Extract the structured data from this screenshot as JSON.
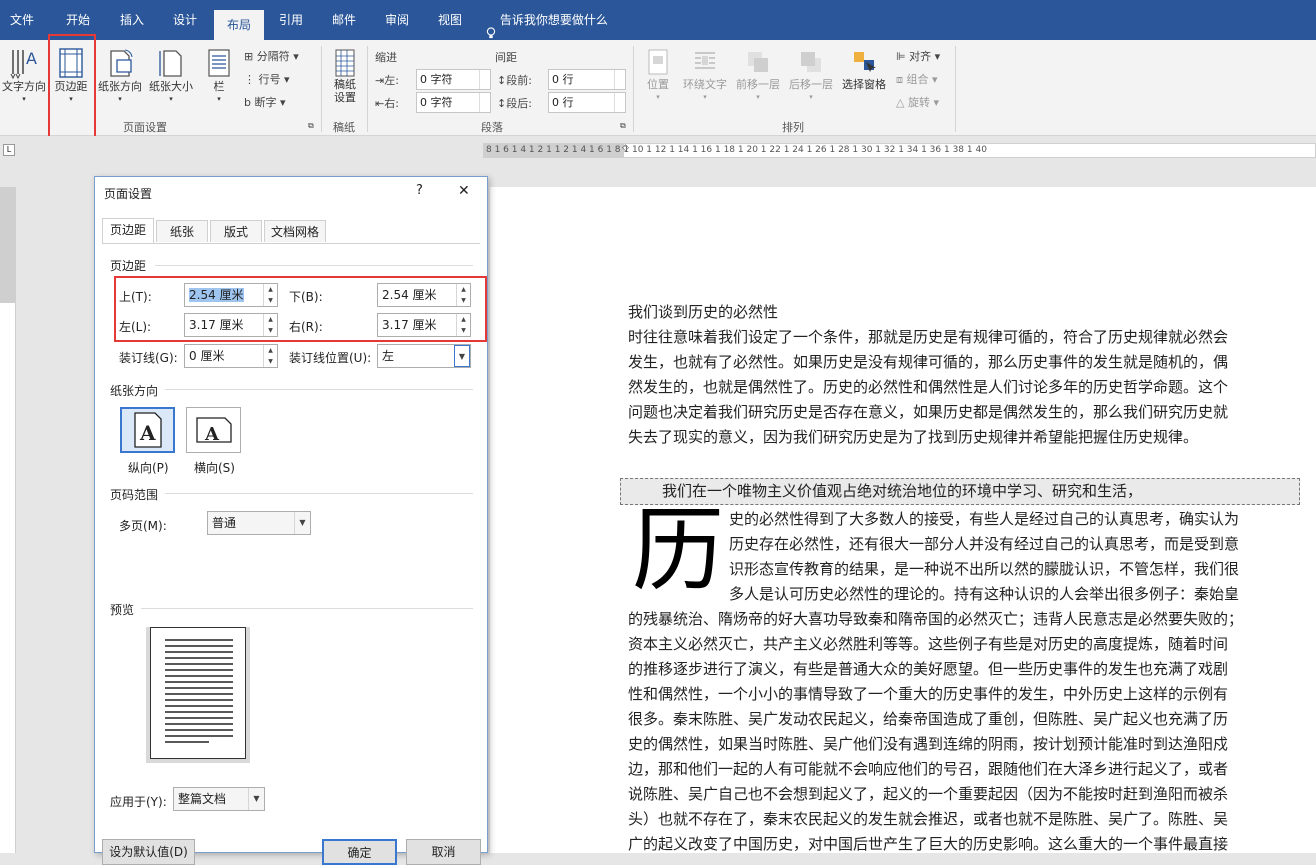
{
  "tabs": [
    {
      "label": "文件",
      "active": false
    },
    {
      "label": "开始",
      "active": false
    },
    {
      "label": "插入",
      "active": false
    },
    {
      "label": "设计",
      "active": false
    },
    {
      "label": "布局",
      "active": true
    },
    {
      "label": "引用",
      "active": false
    },
    {
      "label": "邮件",
      "active": false
    },
    {
      "label": "审阅",
      "active": false
    },
    {
      "label": "视图",
      "active": false
    }
  ],
  "tellme": "告诉我你想要做什么",
  "ribbon": {
    "page_setup": {
      "text_direction": "文字方向",
      "margins": "页边距",
      "orientation": "纸张方向",
      "size": "纸张大小",
      "columns": "栏",
      "breaks": "分隔符",
      "line_numbers": "行号",
      "hyphenation": "断字",
      "group_label": "页面设置"
    },
    "draft": {
      "label1": "稿纸",
      "label2": "设置",
      "group_label": "稿纸"
    },
    "paragraph": {
      "indent_label": "缩进",
      "spacing_label": "间距",
      "left_label": "左:",
      "left_value": "0 字符",
      "right_label": "右:",
      "right_value": "0 字符",
      "before_label": "段前:",
      "before_value": "0 行",
      "after_label": "段后:",
      "after_value": "0 行",
      "group_label": "段落"
    },
    "arrange": {
      "position": "位置",
      "wrap": "环绕文字",
      "forward": "前移一层",
      "backward": "后移一层",
      "selection_pane": "选择窗格",
      "align": "对齐",
      "group": "组合",
      "rotate": "旋转",
      "group_label": "排列"
    }
  },
  "ruler_text": "8  1  6  1  4  1  2  1     1  2  1  4  1  6  1  8  1  10  1  12  1  14  1  16  1  18  1  20  1  22  1  24  1  26  1  28  1  30  1  32  1  34  1  36  1  38  1  40",
  "document": {
    "heading_line": "我们谈到历史的必然性",
    "paragraph1": [
      "时往往意味着我们设定了一个条件，那就是历史是有规律可循的，符合了历史规律就必然会",
      "发生，也就有了必然性。如果历史是没有规律可循的，那么历史事件的发生就是随机的，偶",
      "然发生的，也就是偶然性了。历史的必然性和偶然性是人们讨论多年的历史哲学命题。这个",
      "问题也决定着我们研究历史是否存在意义，如果历史都是偶然发生的，那么我们研究历史就",
      "失去了现实的意义，因为我们研究历史是为了找到历史规律并希望能把握住历史规律。"
    ],
    "boxed_line": "我们在一个唯物主义价值观占绝对统治地位的环境中学习、研究和生活，",
    "drop_cap": "历",
    "paragraph2_indented": [
      "史的必然性得到了大多数人的接受，有些人是经过自己的认真思考，确实认为",
      "历史存在必然性，还有很大一部分人并没有经过自己的认真思考，而是受到意",
      "识形态宣传教育的结果，是一种说不出所以然的朦胧认识，不管怎样，我们很",
      "多人是认可历史必然性的理论的。持有这种认识的人会举出很多例子：秦始皇"
    ],
    "paragraph2_full": [
      "的残暴统治、隋炀帝的好大喜功导致秦和隋帝国的必然灭亡；违背人民意志是必然要失败的；",
      "资本主义必然灭亡，共产主义必然胜利等等。这些例子有些是对历史的高度提炼，随着时间",
      "的推移逐步进行了演义，有些是普通大众的美好愿望。但一些历史事件的发生也充满了戏剧",
      "性和偶然性，一个小小的事情导致了一个重大的历史事件的发生，中外历史上这样的示例有",
      "很多。秦末陈胜、吴广发动农民起义，给秦帝国造成了重创，但陈胜、吴广起义也充满了历",
      "史的偶然性，如果当时陈胜、吴广他们没有遇到连绵的阴雨，按计划预计能准时到达渔阳戍",
      "边，那和他们一起的人有可能就不会响应他们的号召，跟随他们在大泽乡进行起义了，或者",
      "说陈胜、吴广自己也不会想到起义了，起义的一个重要起因（因为不能按时赶到渔阳而被杀",
      "头）也就不存在了，秦末农民起义的发生就会推迟，或者也就不是陈胜、吴广了。陈胜、吴",
      "广的起义改变了中国历史，对中国后世产生了巨大的历史影响。这么重大的一个事件最直接"
    ]
  },
  "dialog": {
    "title": "页面设置",
    "help": "?",
    "close": "✕",
    "tabs": [
      "页边距",
      "纸张",
      "版式",
      "文档网格"
    ],
    "margins_section": "页边距",
    "top_label": "上(T):",
    "top_value": "2.54 厘米",
    "bottom_label": "下(B):",
    "bottom_value": "2.54 厘米",
    "left_label": "左(L):",
    "left_value": "3.17 厘米",
    "right_label": "右(R):",
    "right_value": "3.17 厘米",
    "gutter_label": "装订线(G):",
    "gutter_value": "0 厘米",
    "gutter_pos_label": "装订线位置(U):",
    "gutter_pos_value": "左",
    "orientation_section": "纸张方向",
    "portrait": "纵向(P)",
    "landscape": "横向(S)",
    "pages_section": "页码范围",
    "multiple_pages_label": "多页(M):",
    "multiple_pages_value": "普通",
    "preview_section": "预览",
    "apply_to_label": "应用于(Y):",
    "apply_to_value": "整篇文档",
    "default_button": "设为默认值(D)",
    "ok_button": "确定",
    "cancel_button": "取消"
  },
  "colors": {
    "accent": "#2b579a",
    "highlight_box": "#e53935",
    "selection": "#3a78d0"
  }
}
